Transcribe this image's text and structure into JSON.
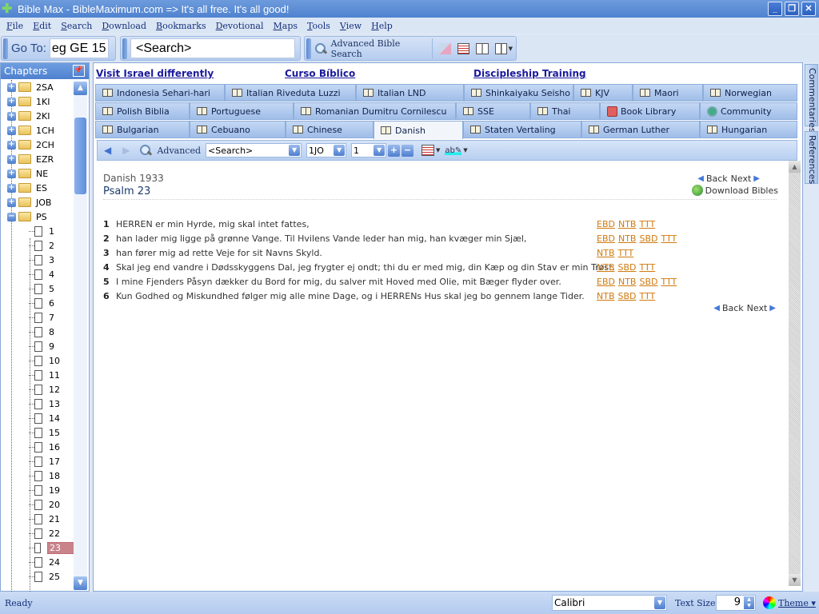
{
  "window": {
    "title": "Bible Max - BibleMaximum.com => It's all free. It's all good!",
    "controls": [
      "_",
      "❐",
      "✕"
    ]
  },
  "menu": [
    "File",
    "Edit",
    "Search",
    "Download",
    "Bookmarks",
    "Devotional",
    "Maps",
    "Tools",
    "View",
    "Help"
  ],
  "toolbar": {
    "goto_label": "Go To:",
    "goto_value": "eg GE 15",
    "search_placeholder": "<Search>",
    "advanced_search_label": "Advanced Bible Search"
  },
  "sidebar": {
    "title": "Chapters",
    "books": [
      "2SA",
      "1KI",
      "2KI",
      "1CH",
      "2CH",
      "EZR",
      "NE",
      "ES",
      "JOB"
    ],
    "expanded_book": "PS",
    "chapters": [
      "1",
      "2",
      "3",
      "4",
      "5",
      "6",
      "7",
      "8",
      "9",
      "10",
      "11",
      "12",
      "13",
      "14",
      "15",
      "16",
      "17",
      "18",
      "19",
      "20",
      "21",
      "22",
      "23",
      "24",
      "25"
    ],
    "selected_chapter": "23"
  },
  "promos": [
    "Visit Israel differently",
    "Curso Bíblico",
    "Discipleship Training"
  ],
  "tabs": {
    "row1": [
      "Indonesia Sehari-hari",
      "Italian Riveduta Luzzi",
      "Italian LND",
      "Shinkaiyaku Seisho",
      "KJV",
      "Maori",
      "Norwegian"
    ],
    "row2": [
      "Polish Biblia",
      "Portuguese",
      "Romanian Dumitru Cornilescu",
      "SSE",
      "Thai",
      "Book Library",
      "Community"
    ],
    "row3": [
      "Bulgarian",
      "Cebuano",
      "Chinese",
      "Danish",
      "Staten Vertaling",
      "German Luther",
      "Hungarian"
    ],
    "active": "Danish"
  },
  "nav_toolbar": {
    "advanced_label": "Advanced",
    "search_value": "<Search>",
    "book_value": "1JO",
    "chapter_value": "1"
  },
  "content": {
    "version": "Danish 1933",
    "chapter_title": "Psalm 23",
    "back_label": "Back",
    "next_label": "Next",
    "download_label": "Download Bibles",
    "verses": [
      {
        "num": "1",
        "text": "HERREN er min Hyrde, mig skal intet fattes,",
        "refs": [
          "EBD",
          "NTB",
          "TTT"
        ]
      },
      {
        "num": "2",
        "text": "han lader mig ligge på grønne Vange. Til Hvilens Vande leder han mig, han kvæger min Sjæl,",
        "refs": [
          "EBD",
          "NTB",
          "SBD",
          "TTT"
        ]
      },
      {
        "num": "3",
        "text": "han fører mig ad rette Veje for sit Navns Skyld.",
        "refs": [
          "NTB",
          "TTT"
        ]
      },
      {
        "num": "4",
        "text": "Skal jeg end vandre i Dødsskyggens Dal, jeg frygter ej ondt; thi du er med mig, din Kæp og din Stav er min Trøst.",
        "refs": [
          "NTB",
          "SBD",
          "TTT"
        ]
      },
      {
        "num": "5",
        "text": "I mine Fjenders Påsyn dækker du Bord for mig, du salver mit Hoved med Olie, mit Bæger flyder over.",
        "refs": [
          "EBD",
          "NTB",
          "SBD",
          "TTT"
        ]
      },
      {
        "num": "6",
        "text": "Kun Godhed og Miskundhed følger mig alle mine Dage, og i HERRENs Hus skal jeg bo gennem lange Tider.",
        "refs": [
          "NTB",
          "SBD",
          "TTT"
        ]
      }
    ]
  },
  "side_tabs": [
    "Commentaries",
    "References"
  ],
  "status": {
    "text": "Ready",
    "font_value": "Calibri",
    "text_size_label": "Text Size",
    "text_size_value": "9",
    "theme_label": "Theme ▾"
  }
}
